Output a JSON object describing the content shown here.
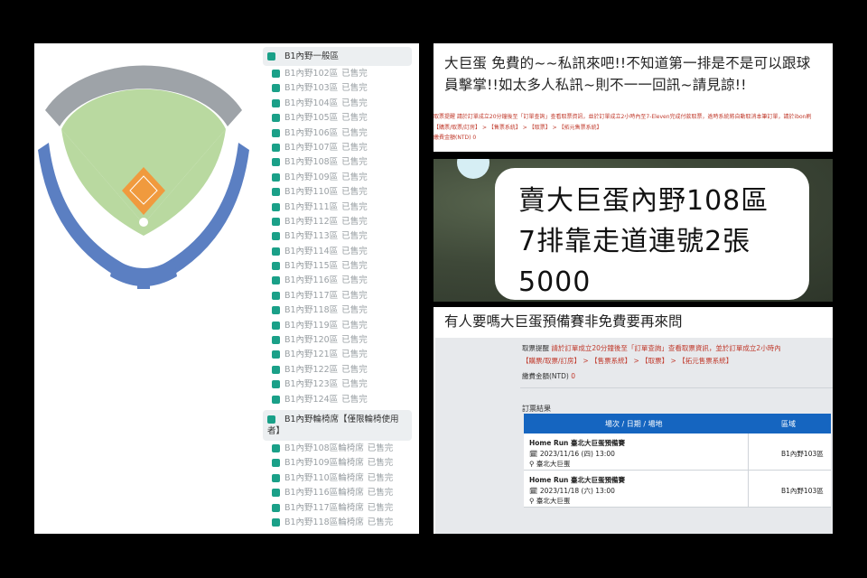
{
  "left_panel": {
    "section1": {
      "title": "B1內野一般區",
      "rows": [
        {
          "name": "B1內野102區",
          "status": "已售完"
        },
        {
          "name": "B1內野103區",
          "status": "已售完"
        },
        {
          "name": "B1內野104區",
          "status": "已售完"
        },
        {
          "name": "B1內野105區",
          "status": "已售完"
        },
        {
          "name": "B1內野106區",
          "status": "已售完"
        },
        {
          "name": "B1內野107區",
          "status": "已售完"
        },
        {
          "name": "B1內野108區",
          "status": "已售完"
        },
        {
          "name": "B1內野109區",
          "status": "已售完"
        },
        {
          "name": "B1內野110區",
          "status": "已售完"
        },
        {
          "name": "B1內野111區",
          "status": "已售完"
        },
        {
          "name": "B1內野112區",
          "status": "已售完"
        },
        {
          "name": "B1內野113區",
          "status": "已售完"
        },
        {
          "name": "B1內野114區",
          "status": "已售完"
        },
        {
          "name": "B1內野115區",
          "status": "已售完"
        },
        {
          "name": "B1內野116區",
          "status": "已售完"
        },
        {
          "name": "B1內野117區",
          "status": "已售完"
        },
        {
          "name": "B1內野118區",
          "status": "已售完"
        },
        {
          "name": "B1內野119區",
          "status": "已售完"
        },
        {
          "name": "B1內野120區",
          "status": "已售完"
        },
        {
          "name": "B1內野121區",
          "status": "已售完"
        },
        {
          "name": "B1內野122區",
          "status": "已售完"
        },
        {
          "name": "B1內野123區",
          "status": "已售完"
        },
        {
          "name": "B1內野124區",
          "status": "已售完"
        }
      ]
    },
    "section2": {
      "title": "B1內野輪椅席【僅限輪椅使用者】",
      "rows": [
        {
          "name": "B1內野108區輪椅席",
          "status": "已售完"
        },
        {
          "name": "B1內野109區輪椅席",
          "status": "已售完"
        },
        {
          "name": "B1內野110區輪椅席",
          "status": "已售完"
        },
        {
          "name": "B1內野116區輪椅席",
          "status": "已售完"
        },
        {
          "name": "B1內野117區輪椅席",
          "status": "已售完"
        },
        {
          "name": "B1內野118區輪椅席",
          "status": "已售完"
        }
      ]
    }
  },
  "top_right": {
    "message": "大巨蛋 免費的~~私訊來吧!!不知道第一排是不是可以跟球員擊掌!!如太多人私訊~則不一一回訊~請見諒!!",
    "notice_line": "取票提醒 請於訂單成立20分鐘後至「訂單查詢」查看取票資訊，並於訂單成立2小時內至7-Eleven完成付款取票，逾時系統將自動取消本筆訂單，請於ibon刷",
    "notice_links": "【購票/取票/訂房】 > 【售票系統】 > 【取票】 > 【拓元售票系統】",
    "amount_label": "繳費金額(NTD) 0"
  },
  "middle_right": {
    "bubble_lines": [
      "賣大巨蛋內野108區",
      "7排靠走道連號2張",
      "5000"
    ]
  },
  "bottom_right": {
    "caption": "有人要嗎大巨蛋預備賽非免費要再來問",
    "notice_prefix": "取票提醒",
    "notice_text": "請於訂單成立20分鐘後至「訂單查詢」查看取票資訊，並於訂單成立2小時內",
    "notice_links": "【購票/取票/訂房】 > 【售票系統】 > 【取票】 > 【拓元售票系統】",
    "amount_label": "繳費金額(NTD)",
    "amount_value": "0",
    "result_title": "訂票結果",
    "table_headers": [
      "場次 / 日期 / 場地",
      "區域"
    ],
    "orders": [
      {
        "event": "Home Run 臺北大巨蛋預備賽",
        "date": "2023/11/16 (四) 13:00",
        "venue": "臺北大巨蛋",
        "area": "B1內野103區"
      },
      {
        "event": "Home Run 臺北大巨蛋預備賽",
        "date": "2023/11/18 (六) 13:00",
        "venue": "臺北大巨蛋",
        "area": "B1內野103區"
      }
    ]
  },
  "colors": {
    "accent": "#1aa088",
    "seat_blue": "#5b7fc2",
    "field_green": "#b9d9a0",
    "infield": "#f09a3e",
    "table_header": "#1565c0"
  }
}
